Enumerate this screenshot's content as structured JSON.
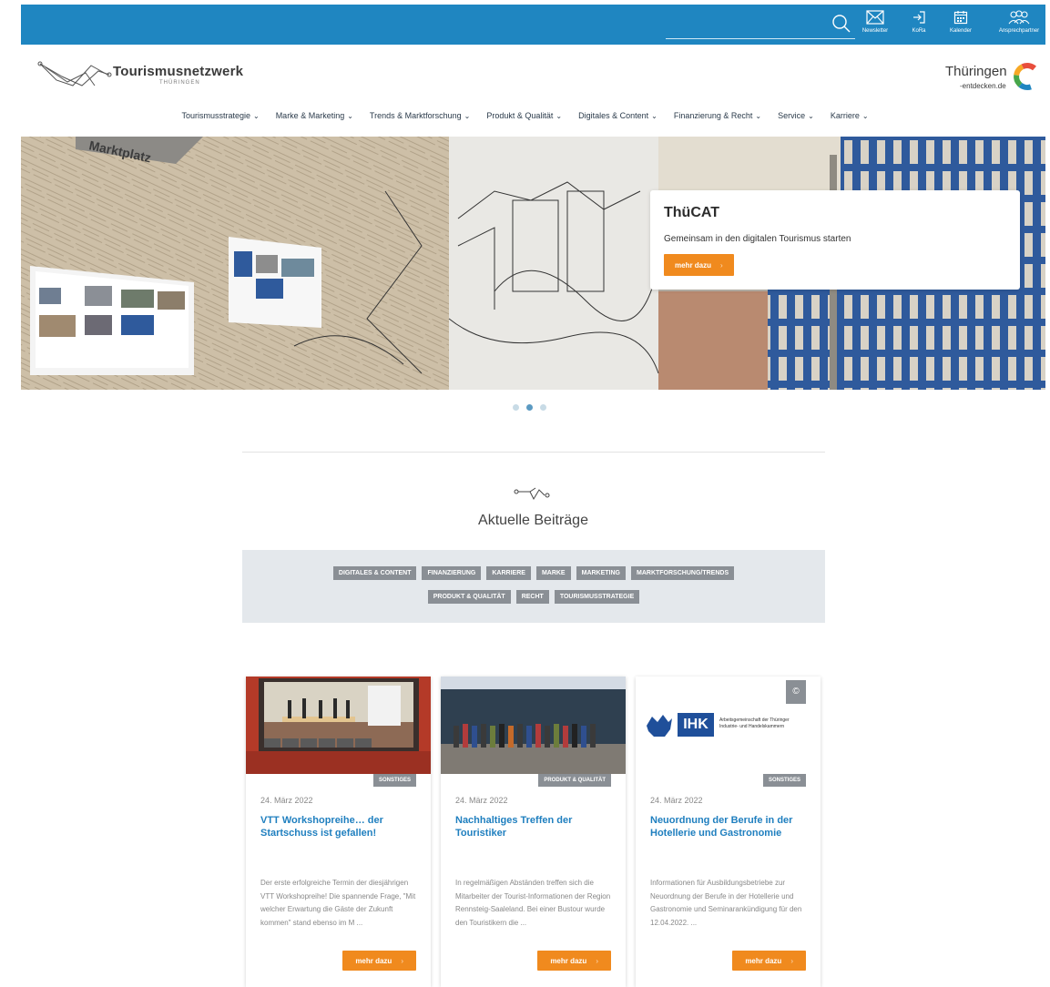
{
  "topbar": {
    "search_placeholder": "",
    "links": [
      {
        "label": "Newsletter",
        "icon": "envelope-icon"
      },
      {
        "label": "KoRa",
        "icon": "login-icon"
      },
      {
        "label": "Kalender",
        "icon": "calendar-icon"
      },
      {
        "label": "Ansprechpartner",
        "icon": "people-icon"
      }
    ]
  },
  "header": {
    "logo_name": "Tourismusnetzwerk",
    "logo_sub": "THÜRINGEN",
    "partner_logo_main": "Thüringen",
    "partner_logo_sub": "-entdecken.de"
  },
  "nav": [
    "Tourismusstrategie",
    "Marke & Marketing",
    "Trends & Marktforschung",
    "Produkt & Qualität",
    "Digitales & Content",
    "Finanzierung & Recht",
    "Service",
    "Karriere"
  ],
  "hero": {
    "wall_sign": "Marktplatz",
    "title": "ThüCAT",
    "text": "Gemeinsam in den digitalen Tourismus starten",
    "button": "mehr dazu",
    "slides": 3,
    "active_slide": 2
  },
  "section": {
    "title": "Aktuelle Beiträge"
  },
  "tags": {
    "row1": [
      "DIGITALES & CONTENT",
      "FINANZIERUNG",
      "KARRIERE",
      "MARKE",
      "MARKETING",
      "MARKTFORSCHUNG/TRENDS"
    ],
    "row2": [
      "PRODUKT & QUALITÄT",
      "RECHT",
      "TOURISMUSSTRATEGIE"
    ]
  },
  "posts": [
    {
      "category": "SONSTIGES",
      "date": "24. März 2022",
      "title": "VTT Workshopreihe… der Startschuss ist gefallen!",
      "excerpt": "Der erste erfolgreiche Termin der diesjährigen VTT Workshopreihe! Die spannende Frage, \"Mit welcher Erwartung die Gäste der Zukunft kommen\" stand ebenso im M ...",
      "button": "mehr dazu"
    },
    {
      "category": "PRODUKT & QUALITÄT",
      "date": "24. März 2022",
      "title": "Nachhaltiges Treffen der Touristiker",
      "excerpt": "In regelmäßigen Abständen treffen sich die Mitarbeiter der Tourist-Informationen der Region Rennsteig-Saaleland. Bei einer Bustour wurde den Touristikern die ...",
      "button": "mehr dazu"
    },
    {
      "category": "SONSTIGES",
      "date": "24. März 2022",
      "title": "Neuordnung der Berufe in der Hotellerie und Gastronomie",
      "excerpt": "Informationen für Ausbildungsbetriebe zur Neuordnung der Berufe in der Hotellerie und Gastronomie und Seminarankündigung für den 12.04.2022. ...",
      "button": "mehr dazu",
      "image_badge": "©",
      "ihk_label": "IHK",
      "ihk_caption_1": "Arbeitsgemeinschaft der Thüringer",
      "ihk_caption_2": "Industrie- und Handelskammern"
    }
  ],
  "colors": {
    "topbar": "#1f86c1",
    "accent": "#f08a1e",
    "link": "#1f7fbf",
    "tag": "#8a8f95"
  }
}
